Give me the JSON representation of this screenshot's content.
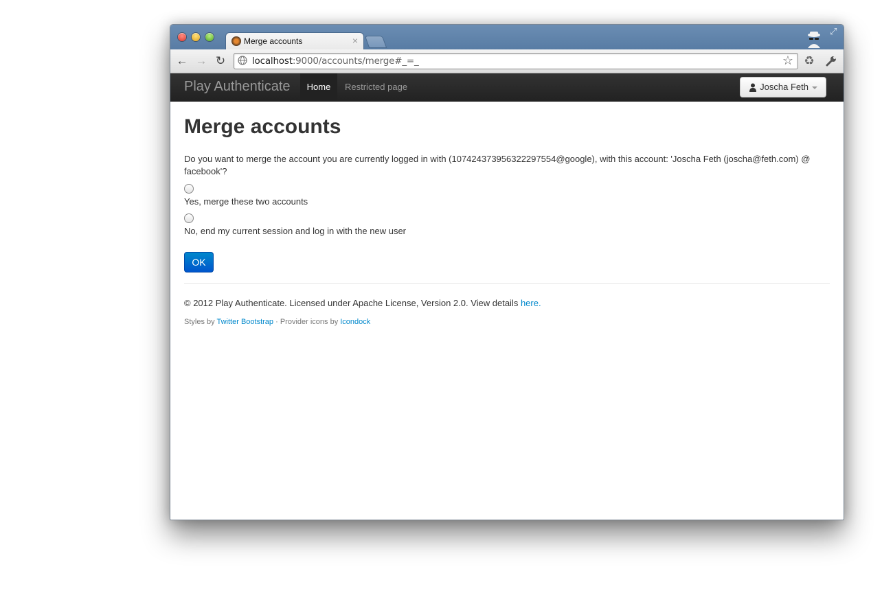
{
  "browser": {
    "tab_title": "Merge accounts",
    "tab_close": "×",
    "url_host": "localhost",
    "url_rest": ":9000/accounts/merge#_=_"
  },
  "navbar": {
    "brand": "Play Authenticate",
    "items": [
      {
        "label": "Home",
        "active": true
      },
      {
        "label": "Restricted page",
        "active": false
      }
    ],
    "user": "Joscha Feth"
  },
  "main": {
    "title": "Merge accounts",
    "prompt": "Do you want to merge the account you are currently logged in with (107424373956322297554@google), with this account: 'Joscha Feth (joscha@feth.com) @ facebook'?",
    "options": [
      {
        "label": "Yes, merge these two accounts",
        "checked": false
      },
      {
        "label": "No, end my current session and log in with the new user",
        "checked": false
      }
    ],
    "submit": "OK"
  },
  "footer": {
    "copyright_text": "© 2012 Play Authenticate. Licensed under Apache License, Version 2.0. View details ",
    "copyright_link": "here.",
    "styles_prefix": "Styles by ",
    "styles_link": "Twitter Bootstrap",
    "icons_prefix": " · Provider icons by ",
    "icons_link": "Icondock"
  },
  "colors": {
    "link": "#0088cc",
    "navbar_bg": "#222222",
    "button_primary": "#0074cc"
  }
}
